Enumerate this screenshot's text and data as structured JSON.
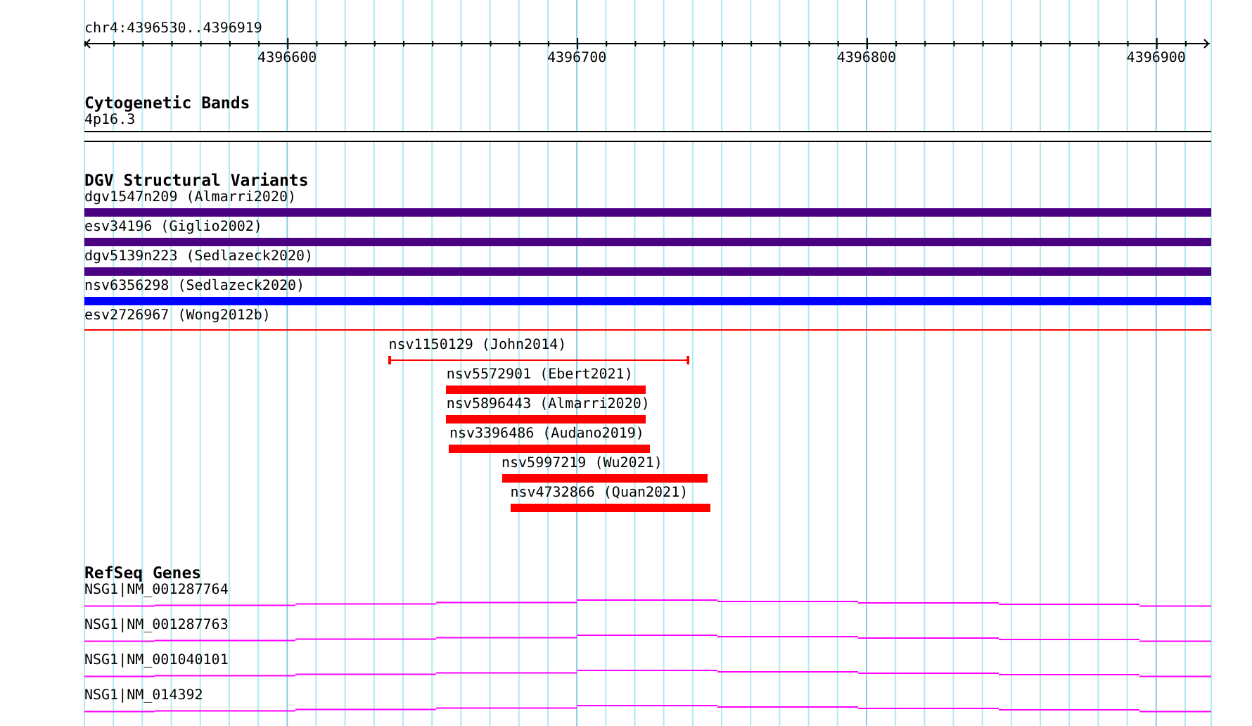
{
  "ruler": {
    "location": "chr4:4396530..4396919",
    "ticks": [
      "4396600",
      "4396700",
      "4396800",
      "4396900"
    ]
  },
  "tracks": [
    {
      "kind": "bands",
      "title": "Cytogenetic Bands",
      "features": [
        {
          "name": "4p16.3"
        }
      ]
    },
    {
      "kind": "variants",
      "title": "DGV Structural Variants",
      "features": [
        {
          "name": "dgv1547n209 (Almarri2020)",
          "kind": "bar",
          "color": "#4b0082"
        },
        {
          "name": "esv34196 (Giglio2002)",
          "kind": "bar",
          "color": "#4b0082"
        },
        {
          "name": "dgv5139n223 (Sedlazeck2020)",
          "kind": "bar",
          "color": "#4b0082"
        },
        {
          "name": "nsv6356298 (Sedlazeck2020)",
          "kind": "bar",
          "color": "#0000ff"
        },
        {
          "name": "esv2726967 (Wong2012b)",
          "kind": "line",
          "color": "#ff0000"
        },
        {
          "name": "nsv1150129 (John2014)",
          "kind": "interval",
          "color": "#ff0000"
        },
        {
          "name": "nsv5572901 (Ebert2021)",
          "kind": "bar",
          "color": "#ff0000"
        },
        {
          "name": "nsv5896443 (Almarri2020)",
          "kind": "bar",
          "color": "#ff0000"
        },
        {
          "name": "nsv3396486 (Audano2019)",
          "kind": "bar",
          "color": "#ff0000"
        },
        {
          "name": "nsv5997219 (Wu2021)",
          "kind": "bar",
          "color": "#ff0000"
        },
        {
          "name": "nsv4732866 (Quan2021)",
          "kind": "bar",
          "color": "#ff0000"
        }
      ]
    },
    {
      "kind": "genes",
      "title": "RefSeq Genes",
      "features": [
        {
          "name": "NSG1|NM_001287764"
        },
        {
          "name": "NSG1|NM_001287763"
        },
        {
          "name": "NSG1|NM_001040101"
        },
        {
          "name": "NSG1|NM_014392"
        }
      ]
    }
  ]
}
